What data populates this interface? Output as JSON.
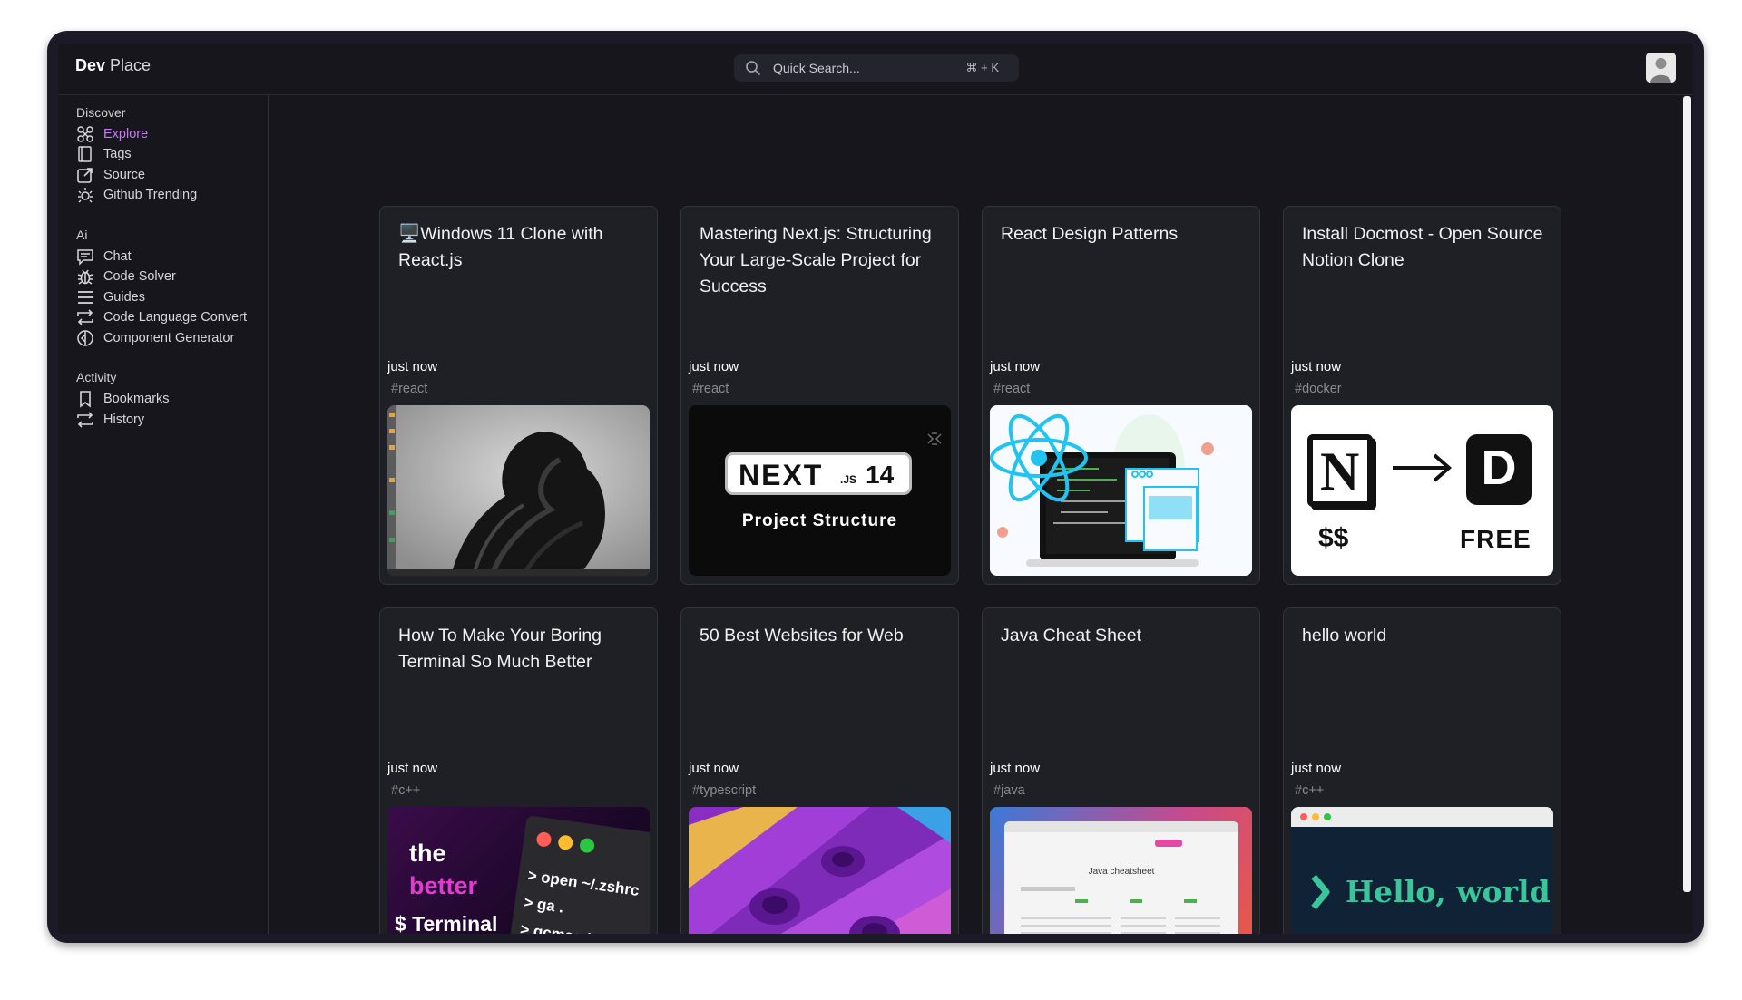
{
  "app": {
    "brand_bold": "Dev",
    "brand_rest": " Place"
  },
  "search": {
    "placeholder": "Quick Search...",
    "shortcut": "⌘ + K"
  },
  "sidebar": {
    "sections": [
      {
        "title": "Discover",
        "items": [
          {
            "label": "Explore",
            "icon": "explore-icon",
            "active": true
          },
          {
            "label": "Tags",
            "icon": "book-icon"
          },
          {
            "label": "Source",
            "icon": "external-link-icon"
          },
          {
            "label": "Github Trending",
            "icon": "sun-burst-icon"
          }
        ]
      },
      {
        "title": "Ai",
        "items": [
          {
            "label": "Chat",
            "icon": "chat-icon"
          },
          {
            "label": "Code Solver",
            "icon": "bug-icon"
          },
          {
            "label": "Guides",
            "icon": "menu-lines-icon"
          },
          {
            "label": "Code Language Convert",
            "icon": "swap-arrows-icon"
          },
          {
            "label": "Component Generator",
            "icon": "component-icon"
          }
        ]
      },
      {
        "title": "Activity",
        "items": [
          {
            "label": "Bookmarks",
            "icon": "bookmark-icon"
          },
          {
            "label": "History",
            "icon": "history-icon"
          }
        ]
      }
    ]
  },
  "cards": [
    {
      "title": "🖥️Windows 11 Clone with React.js",
      "time": "just now",
      "tag": "#react",
      "thumb": "windows-bloom"
    },
    {
      "title": "Mastering Next.js: Structuring Your Large-Scale Project for Success",
      "time": "just now",
      "tag": "#react",
      "thumb": "nextjs-14",
      "thumb_text": {
        "logo": "NEXT",
        "suffix": ".JS",
        "version": "14",
        "caption": "Project Structure"
      }
    },
    {
      "title": "React Design Patterns",
      "time": "just now",
      "tag": "#react",
      "thumb": "react-laptop"
    },
    {
      "title": "Install Docmost - Open Source Notion Clone",
      "time": "just now",
      "tag": "#docker",
      "thumb": "notion-docmost",
      "thumb_text": {
        "left_letter": "N",
        "left_price": "$$",
        "right_letter": "D",
        "right_price": "FREE"
      }
    },
    {
      "title": "How To Make Your Boring Terminal So Much Better",
      "time": "just now",
      "tag": "#c++",
      "thumb": "better-terminal",
      "thumb_text": {
        "line1": "the",
        "line2": "better",
        "line3": "$ Terminal",
        "cmd1": "> open ~/.zshrc",
        "cmd2": "> ga .",
        "cmd3": "> gcmsg '"
      }
    },
    {
      "title": "50 Best Websites for Web",
      "time": "just now",
      "tag": "#typescript",
      "thumb": "purple-cylinders"
    },
    {
      "title": "Java Cheat Sheet",
      "time": "just now",
      "tag": "#java",
      "thumb": "java-cheatsheet",
      "thumb_text": {
        "heading": "Java cheatsheet"
      }
    },
    {
      "title": "hello world",
      "time": "just now",
      "tag": "#c++",
      "thumb": "hello-world",
      "thumb_text": {
        "text": "Hello, world!_"
      }
    }
  ],
  "colors": {
    "background": "#16161c",
    "card": "#1f1f26",
    "accent": "#c47cf2",
    "text": "#d6d6dc"
  }
}
